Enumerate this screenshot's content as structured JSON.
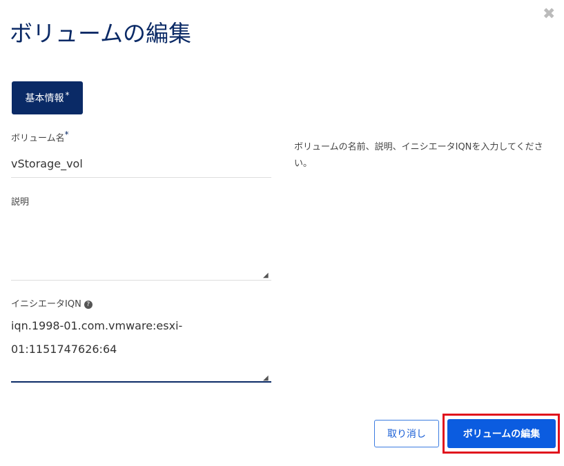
{
  "dialog": {
    "title": "ボリュームの編集",
    "close_icon": "close-icon"
  },
  "tabs": [
    {
      "label": "基本情報",
      "required_mark": "*"
    }
  ],
  "form": {
    "volume_name": {
      "label": "ボリューム名",
      "required_mark": "*",
      "value": "vStorage_vol"
    },
    "description": {
      "label": "説明",
      "value": ""
    },
    "initiator_iqn": {
      "label": "イニシエータIQN",
      "help_icon": "?",
      "value_line1": "iqn.1998-01.com.vmware:esxi-",
      "value_line2": "01:1151747626:64"
    }
  },
  "help_text": "ボリュームの名前、説明、イニシエータIQNを入力してください。",
  "buttons": {
    "cancel": "取り消し",
    "submit": "ボリュームの編集"
  },
  "colors": {
    "primary": "#0b5ce0",
    "navy": "#0a2a66",
    "highlight": "#e0101c"
  }
}
